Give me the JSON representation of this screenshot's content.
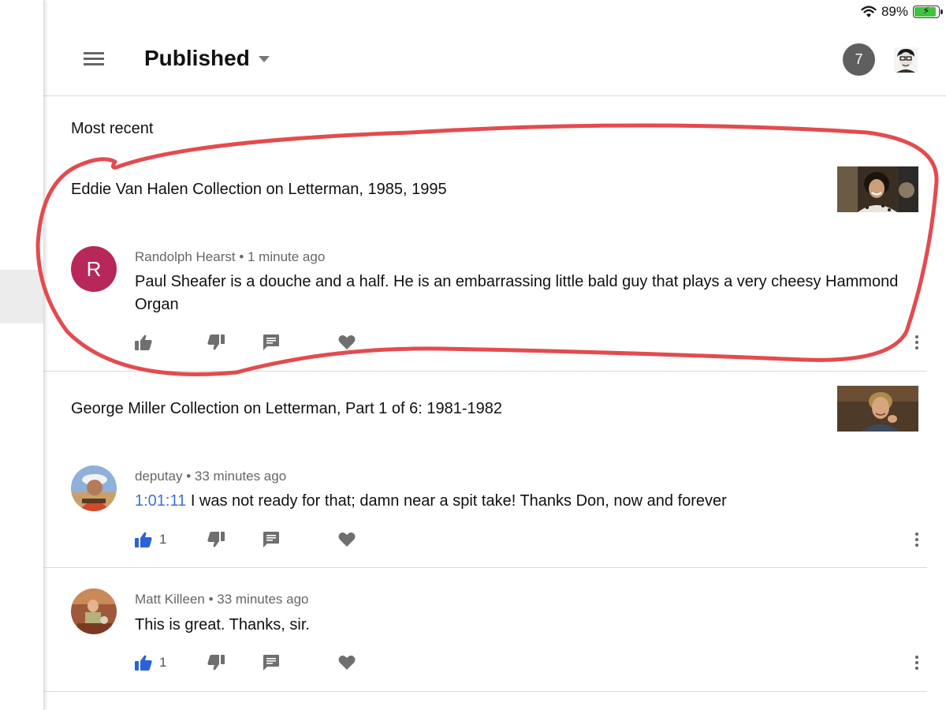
{
  "status_bar": {
    "battery_percent_label": "89%",
    "battery_level": 0.89,
    "battery_color": "#3fc43f"
  },
  "header": {
    "title": "Published",
    "menu_icon": "hamburger-menu-icon",
    "notification_count": "7",
    "notification_badge_color": "#5f5f5f"
  },
  "section": {
    "label": "Most recent"
  },
  "groups": [
    {
      "video_title": "Eddie Van Halen Collection on Letterman, 1985, 1995",
      "comments": [
        {
          "author": "Randolph Hearst",
          "time": "1 minute ago",
          "avatar_letter": "R",
          "avatar_color": "#b7275a",
          "timestamp_link": "",
          "text": "Paul Sheafer is a douche and a half. He is an embarrassing little bald guy that plays a very cheesy Hammond Organ",
          "likes": "",
          "liked": false
        }
      ]
    },
    {
      "video_title": "George Miller Collection on Letterman, Part 1 of 6: 1981-1982",
      "comments": [
        {
          "author": "deputay",
          "time": "33 minutes ago",
          "timestamp_link": "1:01:11",
          "text": "I was not ready for that; damn near a spit take!  Thanks Don, now and forever",
          "likes": "1",
          "liked": true
        },
        {
          "author": "Matt Killeen",
          "time": "33 minutes ago",
          "timestamp_link": "",
          "text": "This is great. Thanks, sir.",
          "likes": "1",
          "liked": true
        }
      ]
    }
  ],
  "colors": {
    "liked_blue": "#2a62d4",
    "icon_gray": "#6f6f6f",
    "annotation_red": "#e34b4f",
    "timestamp_link": "#3b73d6"
  },
  "icons": {
    "like": "thumbs-up-icon",
    "dislike": "thumbs-down-icon",
    "reply": "reply-comment-icon",
    "heart": "heart-icon",
    "more": "more-vert-icon"
  }
}
